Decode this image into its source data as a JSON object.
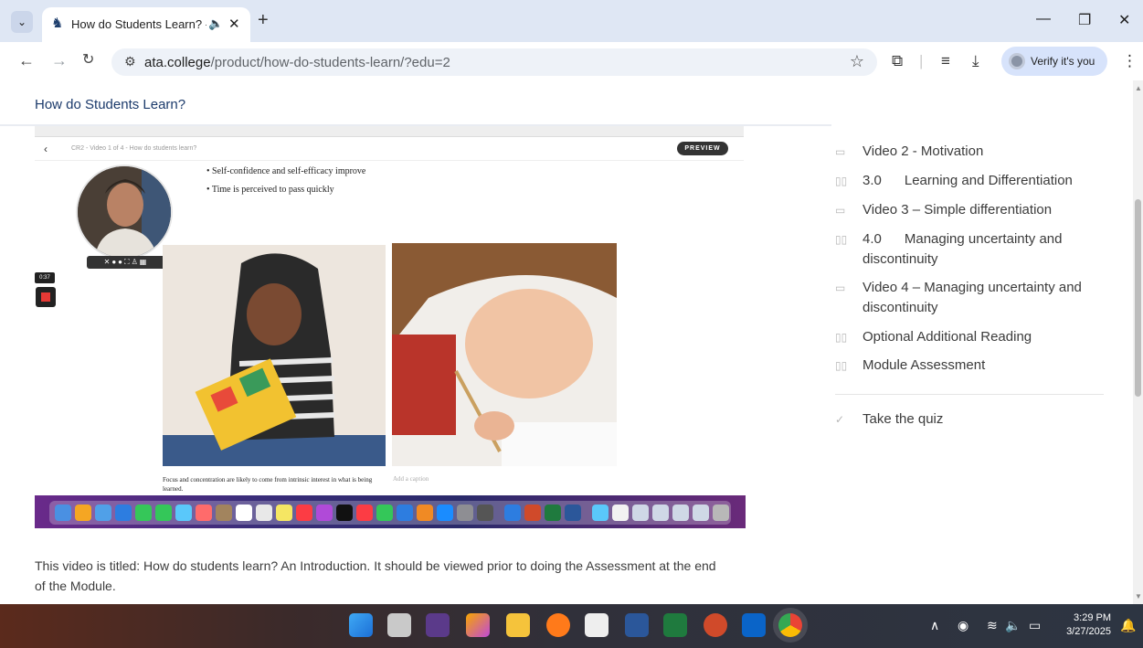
{
  "browser": {
    "tab_title": "How do Students Learn? - A",
    "audio_icon": "speaker-icon",
    "new_tab": "+",
    "window_controls": {
      "minimize": "—",
      "restore": "❐",
      "close": "✕"
    },
    "url_host": "ata.college",
    "url_path": "/product/how-do-students-learn/?edu=2",
    "profile_label": "Verify it's you",
    "accent": "#d7e3fb"
  },
  "page": {
    "title": "How do Students Learn?",
    "video": {
      "breadcrumb": "CR2 - Video 1 of 4 - How do students learn?",
      "preview_label": "PREVIEW",
      "bullets": [
        "Self-confidence and self-efficacy improve",
        "Time is perceived to pass quickly"
      ],
      "timer": "0:37",
      "caption": "Focus and concentration are likely to come from intrinsic interest in what is being learned.",
      "caption_placeholder": "Add a caption"
    },
    "description": "This video is titled: How do students learn? An Introduction. It should be viewed prior to doing the Assessment at the end of the Module."
  },
  "sidebar": {
    "items": [
      {
        "icon": "video-icon",
        "label": "Video 2 - Motivation"
      },
      {
        "icon": "book-icon",
        "label": "3.0      Learning and Differentiation"
      },
      {
        "icon": "video-icon",
        "label": "Video 3 – Simple differentiation"
      },
      {
        "icon": "book-icon",
        "label": "4.0      Managing uncertainty and discontinuity"
      },
      {
        "icon": "video-icon",
        "label": "Video 4 – Managing uncertainty and discontinuity"
      },
      {
        "icon": "book-icon",
        "label": "Optional Additional Reading"
      },
      {
        "icon": "book-icon",
        "label": "Module Assessment"
      }
    ],
    "quiz_label": "Take the quiz"
  },
  "taskbar": {
    "time": "3:29 PM",
    "date": "3/27/2025"
  }
}
